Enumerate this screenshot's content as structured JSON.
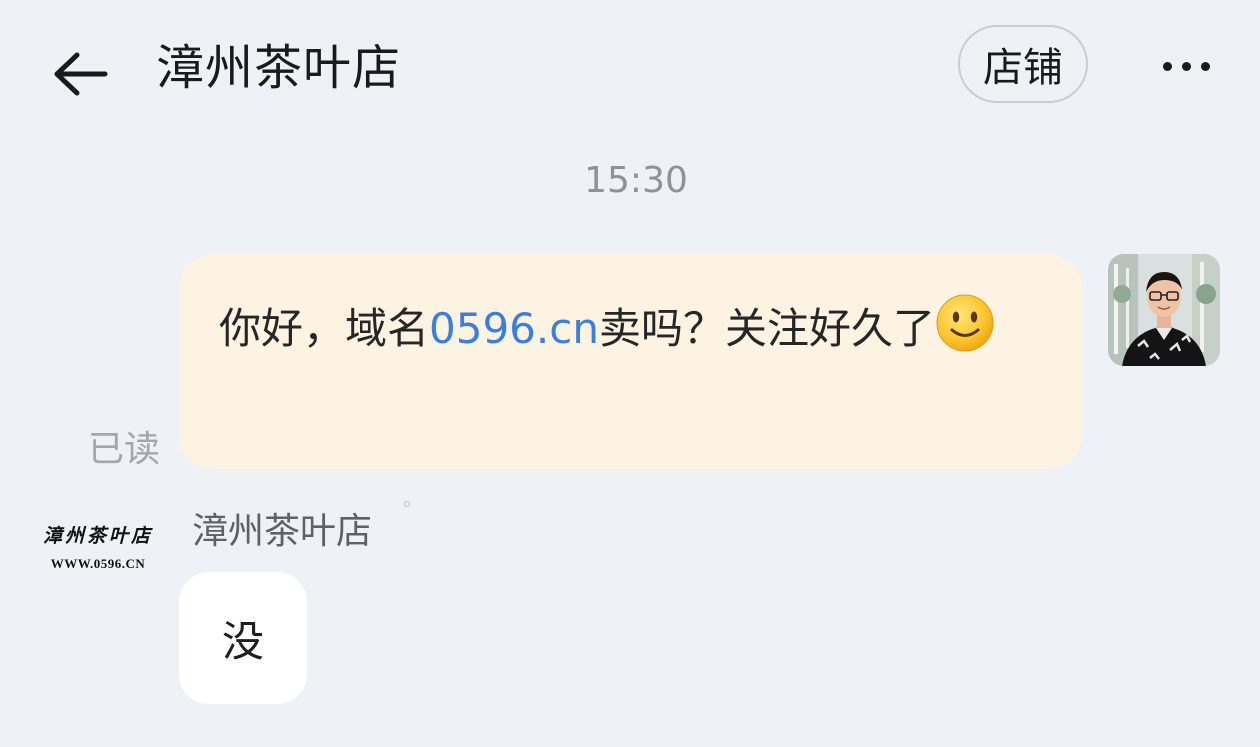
{
  "header": {
    "title": "漳州茶叶店",
    "shop_button": "店铺",
    "back_icon": "arrow-left-icon",
    "more_icon": "more-horizontal-icon"
  },
  "conversation": {
    "timestamp": "15:30",
    "sent_message": {
      "text_before_link": "你好，域名",
      "link_text": "0596.cn",
      "text_after_link": "卖吗？关注好久了",
      "emoji": "slightly-smiling-face-icon",
      "status": "已读"
    },
    "received_message": {
      "sender_name": "漳州茶叶店",
      "avatar_logo_text": "漳州茶叶店",
      "avatar_logo_url": "WWW.0596.CN",
      "text": "没"
    }
  },
  "colors": {
    "background": "#eef1f6",
    "sent_bubble": "#fdf3e3",
    "received_bubble": "#ffffff",
    "link": "#3a7ee0",
    "muted_text": "#8e9197"
  }
}
